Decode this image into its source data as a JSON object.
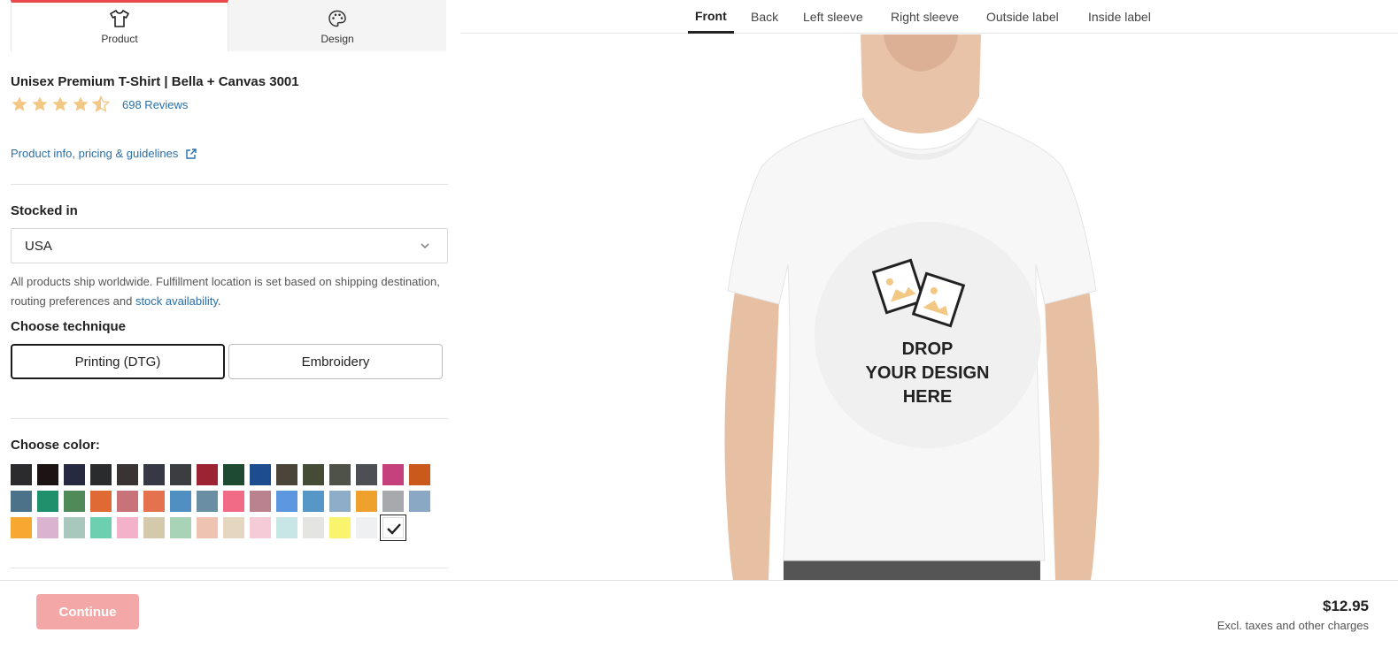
{
  "left_tabs": [
    {
      "label": "Product",
      "icon": "tshirt-icon",
      "active": true
    },
    {
      "label": "Design",
      "icon": "palette-icon",
      "active": false
    }
  ],
  "product": {
    "title": "Unisex Premium T-Shirt | Bella + Canvas 3001",
    "rating": 4.5,
    "rating_max": 5,
    "reviews_label": "698 Reviews",
    "info_link": "Product info, pricing & guidelines"
  },
  "stock": {
    "label": "Stocked in",
    "selected": "USA",
    "note_prefix": "All products ship worldwide. Fulfillment location is set based on shipping destination, routing preferences and ",
    "note_link": "stock availability",
    "note_suffix": "."
  },
  "technique": {
    "label": "Choose technique",
    "options": [
      "Printing (DTG)",
      "Embroidery"
    ],
    "selected": "Printing (DTG)"
  },
  "color": {
    "label": "Choose color:",
    "rows": [
      [
        "#2b2b2d",
        "#1c1414",
        "#252a40",
        "#2a2b2d",
        "#3a3334",
        "#363846",
        "#3c3d40",
        "#9c2331",
        "#1e4a32",
        "#1d4c8f",
        "#4b4438",
        "#454c36",
        "#4e5249",
        "#4c4f53",
        "#c4417e",
        "#c95a1c"
      ],
      [
        "#4b7289",
        "#1f8f6c",
        "#4f8a58",
        "#e06a34",
        "#c9727a",
        "#e4724e",
        "#4f8fc1",
        "#6a8ea3",
        "#f26b86",
        "#b9828e",
        "#5c97e0",
        "#5797c7",
        "#8eadc9",
        "#f0a02c",
        "#a7a9ac",
        "#8aa8c4"
      ],
      [
        "#f6a830",
        "#d9b3d0",
        "#a8c8bd",
        "#6ccfb0",
        "#f3b2ca",
        "#d5c9ac",
        "#a8d3b7",
        "#eec3b1",
        "#e4d6bf",
        "#f6cbd8",
        "#c8e6e5",
        "#e4e5e1",
        "#faf36e",
        "#eef0f2",
        "#ffffff"
      ]
    ],
    "checked_index": [
      2,
      14
    ]
  },
  "footer": {
    "continue_label": "Continue",
    "price": "$12.95",
    "price_note": "Excl. taxes and other charges"
  },
  "view_tabs": [
    {
      "label": "Front",
      "active": true
    },
    {
      "label": "Back",
      "active": false
    },
    {
      "label": "Left sleeve",
      "active": false
    },
    {
      "label": "Right sleeve",
      "active": false
    },
    {
      "label": "Outside label",
      "active": false
    },
    {
      "label": "Inside label",
      "active": false
    }
  ],
  "preview": {
    "drop_line1": "DROP",
    "drop_line2": "YOUR DESIGN",
    "drop_line3": "HERE",
    "accent": "#f3c784"
  }
}
